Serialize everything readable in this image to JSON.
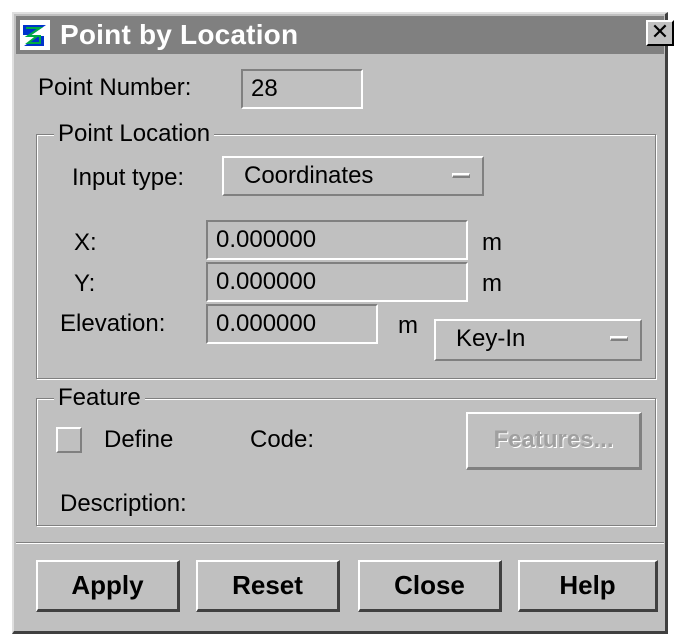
{
  "window": {
    "title": "Point by Location",
    "close_glyph": "✕"
  },
  "point_number": {
    "label": "Point Number:",
    "value": "28"
  },
  "point_location": {
    "group_title": "Point Location",
    "input_type": {
      "label": "Input type:",
      "selected": "Coordinates"
    },
    "x": {
      "label": "X:",
      "value": "0.000000",
      "unit": "m"
    },
    "y": {
      "label": "Y:",
      "value": "0.000000",
      "unit": "m"
    },
    "elevation": {
      "label": "Elevation:",
      "value": "0.000000",
      "unit": "m",
      "mode": "Key-In"
    }
  },
  "feature": {
    "group_title": "Feature",
    "define_label": "Define",
    "code_label": "Code:",
    "features_button": "Features...",
    "description_label": "Description:"
  },
  "buttons": {
    "apply": "Apply",
    "reset": "Reset",
    "close": "Close",
    "help": "Help"
  },
  "colors": {
    "face": "#c0c0c0",
    "titlebar": "#808080",
    "title_text": "#ffffff"
  }
}
